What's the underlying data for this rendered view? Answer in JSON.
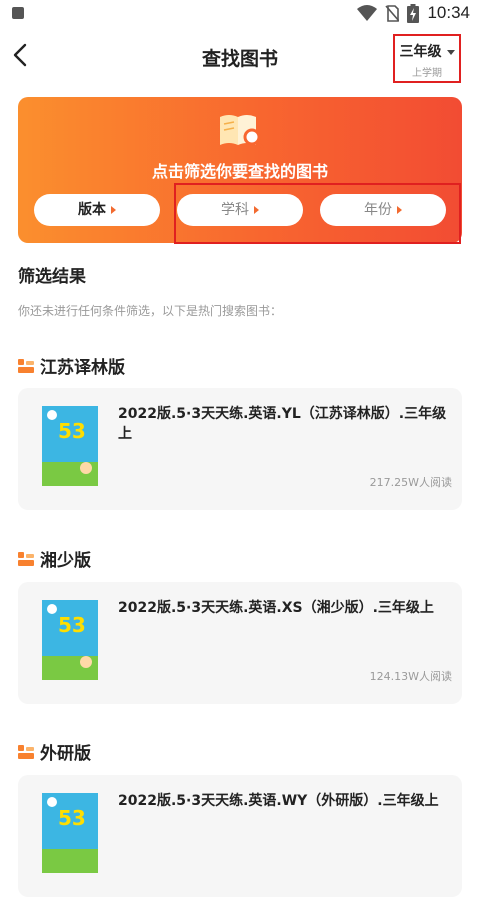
{
  "status_bar": {
    "time": "10:34"
  },
  "header": {
    "title": "查找图书",
    "grade": "三年级",
    "term": "上学期"
  },
  "banner": {
    "prompt": "点击筛选你要查找的图书",
    "filters": [
      {
        "label": "版本"
      },
      {
        "label": "学科"
      },
      {
        "label": "年份"
      }
    ]
  },
  "results": {
    "title": "筛选结果",
    "hint": "你还未进行任何条件筛选，以下是热门搜索图书："
  },
  "groups": [
    {
      "edition": "江苏译林版",
      "book_title": "2022版.5·3天天练.英语.YL（江苏译林版）.三年级上",
      "reads": "217.25W人阅读"
    },
    {
      "edition": "湘少版",
      "book_title": "2022版.5·3天天练.英语.XS（湘少版）.三年级上",
      "reads": "124.13W人阅读"
    },
    {
      "edition": "外研版",
      "book_title": "2022版.5·3天天练.英语.WY（外研版）.三年级上",
      "reads": ""
    }
  ],
  "colors": {
    "accent": "#f8662f",
    "highlight_outline": "#e02020",
    "card_bg": "#f6f6f6"
  },
  "icons": [
    "back-arrow-icon",
    "wifi-icon",
    "no-sim-icon",
    "battery-icon",
    "book-search-icon",
    "edition-icon"
  ]
}
